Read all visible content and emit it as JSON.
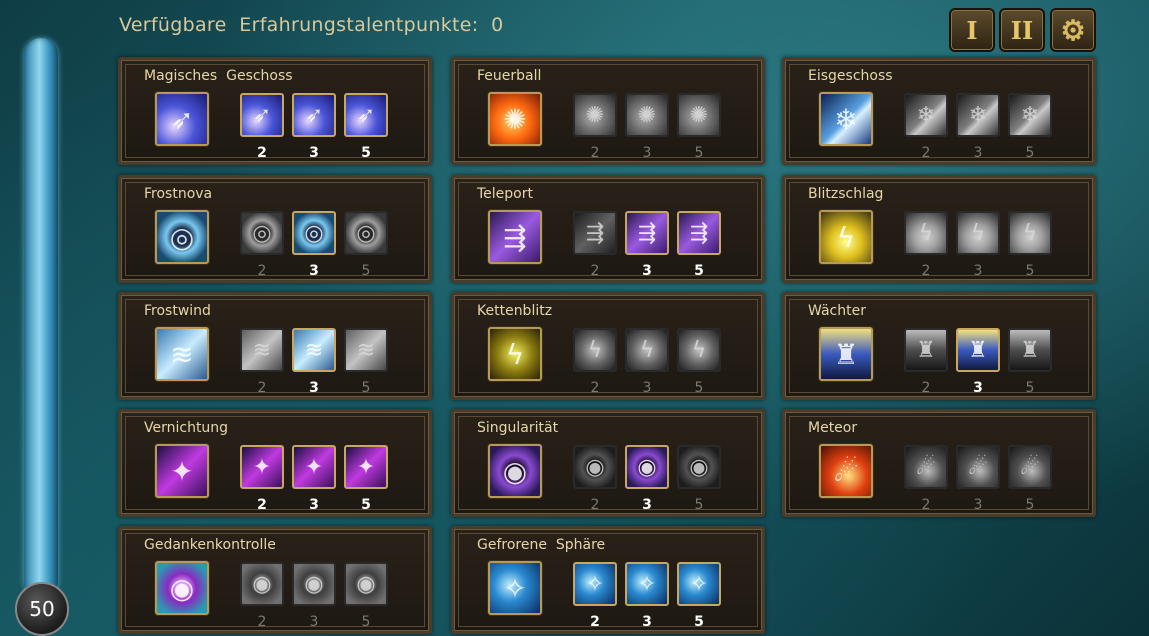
{
  "header": {
    "title": "Verfügbare  Erfahrungstalentpunkte:  0",
    "tab1_label": "I",
    "tab2_label": "II",
    "settings_icon": "gear-icon"
  },
  "player": {
    "level": "50"
  },
  "skills": [
    {
      "name": "Magisches  Geschoss",
      "icon": "magic-missile-icon",
      "ranks": [
        {
          "label": "2",
          "active": true
        },
        {
          "label": "3",
          "active": true
        },
        {
          "label": "5",
          "active": true
        }
      ]
    },
    {
      "name": "Feuerball",
      "icon": "fireball-icon",
      "ranks": [
        {
          "label": "2",
          "active": false
        },
        {
          "label": "3",
          "active": false
        },
        {
          "label": "5",
          "active": false
        }
      ]
    },
    {
      "name": "Eisgeschoss",
      "icon": "ice-bolt-icon",
      "ranks": [
        {
          "label": "2",
          "active": false
        },
        {
          "label": "3",
          "active": false
        },
        {
          "label": "5",
          "active": false
        }
      ]
    },
    {
      "name": "Frostnova",
      "icon": "frost-nova-icon",
      "ranks": [
        {
          "label": "2",
          "active": false
        },
        {
          "label": "3",
          "active": true
        },
        {
          "label": "5",
          "active": false
        }
      ]
    },
    {
      "name": "Teleport",
      "icon": "teleport-icon",
      "ranks": [
        {
          "label": "2",
          "active": false
        },
        {
          "label": "3",
          "active": true
        },
        {
          "label": "5",
          "active": true
        }
      ]
    },
    {
      "name": "Blitzschlag",
      "icon": "lightning-icon",
      "ranks": [
        {
          "label": "2",
          "active": false
        },
        {
          "label": "3",
          "active": false
        },
        {
          "label": "5",
          "active": false
        }
      ]
    },
    {
      "name": "Frostwind",
      "icon": "frost-wind-icon",
      "ranks": [
        {
          "label": "2",
          "active": false
        },
        {
          "label": "3",
          "active": true
        },
        {
          "label": "5",
          "active": false
        }
      ]
    },
    {
      "name": "Kettenblitz",
      "icon": "chain-lightning-icon",
      "ranks": [
        {
          "label": "2",
          "active": false
        },
        {
          "label": "3",
          "active": false
        },
        {
          "label": "5",
          "active": false
        }
      ]
    },
    {
      "name": "Wächter",
      "icon": "guardian-icon",
      "ranks": [
        {
          "label": "2",
          "active": false
        },
        {
          "label": "3",
          "active": true
        },
        {
          "label": "5",
          "active": false
        }
      ]
    },
    {
      "name": "Vernichtung",
      "icon": "annihilation-icon",
      "ranks": [
        {
          "label": "2",
          "active": true
        },
        {
          "label": "3",
          "active": true
        },
        {
          "label": "5",
          "active": true
        }
      ]
    },
    {
      "name": "Singularität",
      "icon": "singularity-icon",
      "ranks": [
        {
          "label": "2",
          "active": false
        },
        {
          "label": "3",
          "active": true
        },
        {
          "label": "5",
          "active": false
        }
      ]
    },
    {
      "name": "Meteor",
      "icon": "meteor-icon",
      "ranks": [
        {
          "label": "2",
          "active": false
        },
        {
          "label": "3",
          "active": false
        },
        {
          "label": "5",
          "active": false
        }
      ]
    },
    {
      "name": "Gedankenkontrolle",
      "icon": "mind-control-icon",
      "ranks": [
        {
          "label": "2",
          "active": false
        },
        {
          "label": "3",
          "active": false
        },
        {
          "label": "5",
          "active": false
        }
      ]
    },
    {
      "name": "Gefrorene  Sphäre",
      "icon": "frozen-sphere-icon",
      "ranks": [
        {
          "label": "2",
          "active": true
        },
        {
          "label": "3",
          "active": true
        },
        {
          "label": "5",
          "active": true
        }
      ]
    }
  ]
}
